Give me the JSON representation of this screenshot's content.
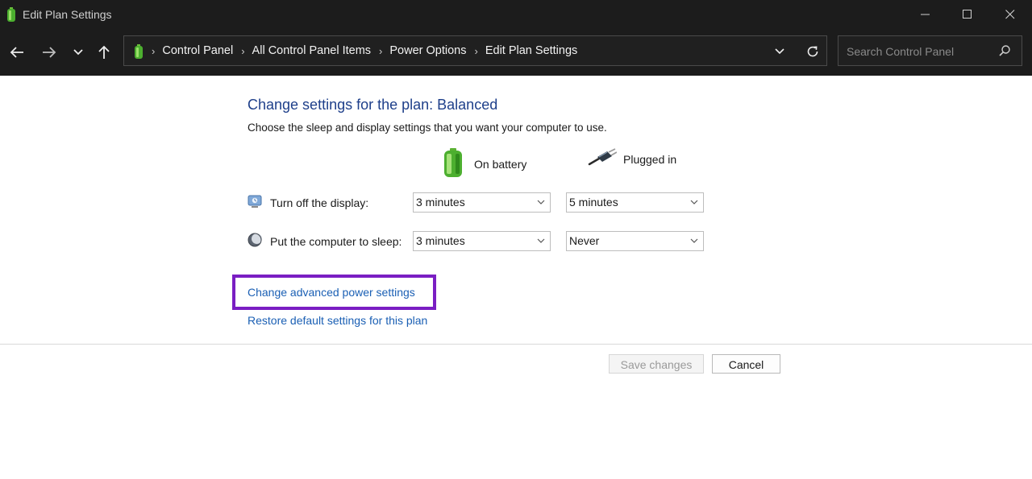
{
  "window": {
    "title": "Edit Plan Settings",
    "controls": [
      "minimize-icon",
      "maximize-icon",
      "close-icon"
    ]
  },
  "nav": {
    "breadcrumbs": [
      "Control Panel",
      "All Control Panel Items",
      "Power Options",
      "Edit Plan Settings"
    ],
    "search_placeholder": "Search Control Panel"
  },
  "content": {
    "heading": "Change settings for the plan: Balanced",
    "subtext": "Choose the sleep and display settings that you want your computer to use.",
    "columns": {
      "battery": "On battery",
      "plugged": "Plugged in"
    },
    "rows": [
      {
        "label": "Turn off the display:",
        "battery": "3 minutes",
        "plugged": "5 minutes"
      },
      {
        "label": "Put the computer to sleep:",
        "battery": "3 minutes",
        "plugged": "Never"
      }
    ],
    "links": {
      "advanced": "Change advanced power settings",
      "restore": "Restore default settings for this plan"
    },
    "highlight_color": "#7a1ec3"
  },
  "buttons": {
    "save": "Save changes",
    "cancel": "Cancel"
  },
  "colors": {
    "titlebar": "#1c1c1c",
    "heading": "#1e3f8a",
    "link": "#1a5fb4"
  }
}
